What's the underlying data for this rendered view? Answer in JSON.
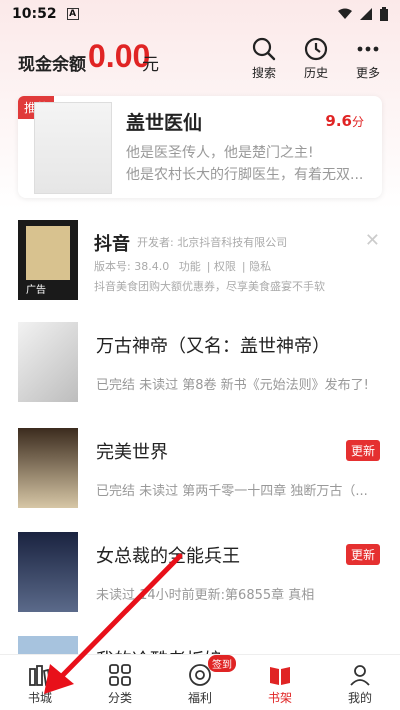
{
  "status_bar": {
    "time": "10:52",
    "indicator": "A"
  },
  "header": {
    "balance_label": "现金余额",
    "balance_value": "0.00",
    "balance_unit": "元",
    "actions": [
      {
        "label": "搜索",
        "icon": "search-icon"
      },
      {
        "label": "历史",
        "icon": "clock-icon"
      },
      {
        "label": "更多",
        "icon": "more-dots-icon"
      }
    ]
  },
  "featured": {
    "badge": "推荐",
    "title": "盖世医仙",
    "score": "9.6",
    "score_unit": "分",
    "desc_line1": "他是医圣传人，他是楚门之主!",
    "desc_line2": "他是农村长大的行脚医生，有着无双..."
  },
  "ad": {
    "app_name": "抖音",
    "developer": "开发者: 北京抖音科技有限公司",
    "version": "版本号: 38.4.0",
    "links": [
      "功能",
      "权限",
      "隐私"
    ],
    "slogan": "抖音美食团购大额优惠券，尽享美食盛宴不手软",
    "ad_mark": "广告"
  },
  "books": [
    {
      "title": "万古神帝（又名：盖世神帝）",
      "info": "已完结 未读过 第8卷 新书《元始法则》发布了!",
      "badge": ""
    },
    {
      "title": "完美世界",
      "info": "已完结 未读过 第两千零一十四章 独断万古（...",
      "badge": "更新"
    },
    {
      "title": "女总裁的全能兵王",
      "info": "未读过 14小时前更新:第6855章 真相",
      "badge": "更新"
    },
    {
      "title": "我的冷酷老板娘",
      "info": "",
      "badge": ""
    }
  ],
  "tabbar": {
    "items": [
      {
        "label": "书城",
        "icon": "bookstore-icon"
      },
      {
        "label": "分类",
        "icon": "category-icon"
      },
      {
        "label": "福利",
        "icon": "welfare-icon"
      },
      {
        "label": "书架",
        "icon": "bookshelf-icon"
      },
      {
        "label": "我的",
        "icon": "profile-icon"
      }
    ],
    "active": "书架",
    "sign_badge": "签到"
  },
  "colors": {
    "accent": "#e02424",
    "muted": "#999999"
  }
}
